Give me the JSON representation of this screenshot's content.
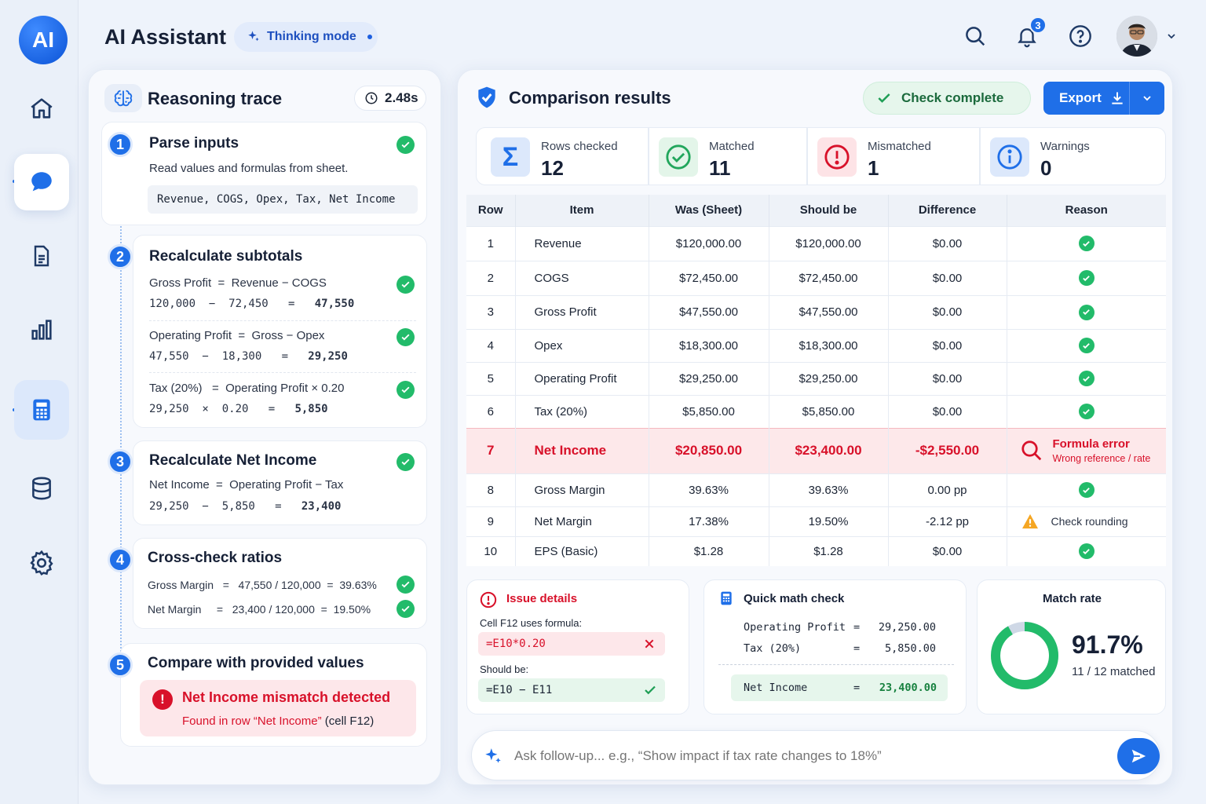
{
  "app": {
    "logo": "AI",
    "title": "AI Assistant",
    "mode": "Thinking mode",
    "notifications": "3"
  },
  "sidebar": {
    "items": [
      {
        "icon": "home-icon"
      },
      {
        "icon": "chat-icon"
      },
      {
        "icon": "document-icon"
      },
      {
        "icon": "chart-icon"
      },
      {
        "icon": "calculator-icon"
      },
      {
        "icon": "database-icon"
      },
      {
        "icon": "settings-icon"
      }
    ]
  },
  "trace": {
    "title": "Reasoning trace",
    "time": "2.48s",
    "steps": [
      {
        "num": "1",
        "title": "Parse inputs",
        "desc": "Read values and formulas from sheet.",
        "code": "Revenue, COGS, Opex, Tax, Net Income"
      },
      {
        "num": "2",
        "title": "Recalculate subtotals",
        "lines": [
          {
            "a": "Gross Profit  =  Revenue − COGS",
            "b": "120,000  −  72,450   =   ",
            "r": "47,550"
          },
          {
            "a": "Operating Profit  =  Gross − Opex",
            "b": "47,550  −  18,300   =   ",
            "r": "29,250"
          },
          {
            "a": "Tax (20%)   =  Operating Profit × 0.20",
            "b": "29,250  ×  0.20   =   ",
            "r": "5,850"
          }
        ]
      },
      {
        "num": "3",
        "title": "Recalculate Net Income",
        "a": "Net Income  =  Operating Profit − Tax",
        "b": "29,250  −  5,850   =   ",
        "r": "23,400"
      },
      {
        "num": "4",
        "title": "Cross-check ratios",
        "lines": [
          "Gross Margin   =   47,550 / 120,000  =  39.63%",
          "Net Margin     =   23,400 / 120,000  =  19.50%"
        ]
      },
      {
        "num": "5",
        "title": "Compare with provided values",
        "alert_title": "Net Income mismatch detected",
        "alert_pre": "Found in row “Net Income”",
        "alert_post": " (cell F12)"
      }
    ]
  },
  "results": {
    "title": "Comparison results",
    "status": "Check complete",
    "export": "Export",
    "stats": [
      {
        "label": "Rows checked",
        "value": "12"
      },
      {
        "label": "Matched",
        "value": "11"
      },
      {
        "label": "Mismatched",
        "value": "1"
      },
      {
        "label": "Warnings",
        "value": "0"
      }
    ],
    "columns": [
      "Row",
      "Item",
      "Was (Sheet)",
      "Should be",
      "Difference",
      "Reason"
    ],
    "rows": [
      {
        "row": "1",
        "item": "Revenue",
        "was": "$120,000.00",
        "should": "$120,000.00",
        "diff": "$0.00",
        "reason": "ok"
      },
      {
        "row": "2",
        "item": "COGS",
        "was": "$72,450.00",
        "should": "$72,450.00",
        "diff": "$0.00",
        "reason": "ok"
      },
      {
        "row": "3",
        "item": "Gross Profit",
        "was": "$47,550.00",
        "should": "$47,550.00",
        "diff": "$0.00",
        "reason": "ok"
      },
      {
        "row": "4",
        "item": "Opex",
        "was": "$18,300.00",
        "should": "$18,300.00",
        "diff": "$0.00",
        "reason": "ok"
      },
      {
        "row": "5",
        "item": "Operating Profit",
        "was": "$29,250.00",
        "should": "$29,250.00",
        "diff": "$0.00",
        "reason": "ok"
      },
      {
        "row": "6",
        "item": "Tax (20%)",
        "was": "$5,850.00",
        "should": "$5,850.00",
        "diff": "$0.00",
        "reason": "ok"
      },
      {
        "row": "7",
        "item": "Net Income",
        "was": "$20,850.00",
        "should": "$23,400.00",
        "diff": "-$2,550.00",
        "reason": "error",
        "reason_title": "Formula error",
        "reason_sub": "Wrong reference / rate"
      },
      {
        "row": "8",
        "item": "Gross Margin",
        "was": "39.63%",
        "should": "39.63%",
        "diff": "0.00 pp",
        "reason": "ok"
      },
      {
        "row": "9",
        "item": "Net Margin",
        "was": "17.38%",
        "should": "19.50%",
        "diff": "-2.12 pp",
        "reason": "warning",
        "reason_title": "Check rounding"
      },
      {
        "row": "10",
        "item": "EPS (Basic)",
        "was": "$1.28",
        "should": "$1.28",
        "diff": "$0.00",
        "reason": "ok"
      }
    ]
  },
  "issue": {
    "title": "Issue details",
    "label1": "Cell F12 uses formula:",
    "bad": "=E10*0.20",
    "label2": "Should be:",
    "good": "=E10 − E11"
  },
  "math": {
    "title": "Quick math check",
    "l1k": "Operating Profit",
    "l1v": "29,250.00",
    "l2k": "Tax (20%)",
    "l2v": "5,850.00",
    "rk": "Net Income",
    "rv": "23,400.00",
    "eq": "="
  },
  "match": {
    "title": "Match rate",
    "value": "91.7%",
    "sub": "11 / 12 matched",
    "fraction": 0.917
  },
  "ask": {
    "placeholder": "Ask follow-up... e.g., “Show impact if tax rate changes to 18%”"
  }
}
